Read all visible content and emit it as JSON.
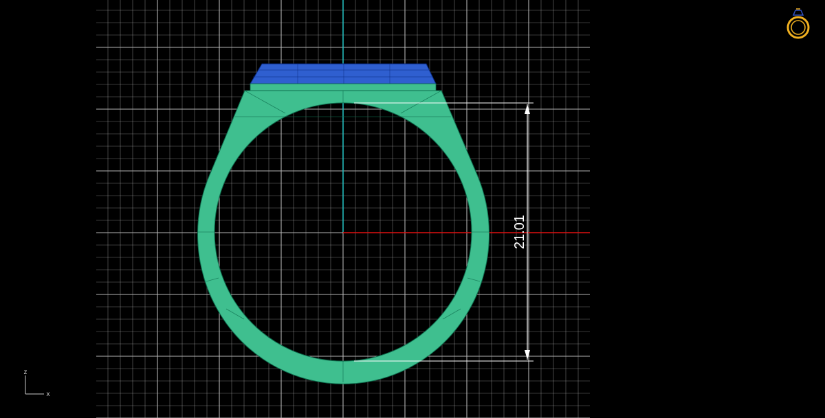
{
  "viewport": {
    "background": "#000000",
    "grid_color": "#bdbdbd",
    "axis_x_color": "#e01010",
    "axis_y_color": "#20c0c0"
  },
  "model": {
    "band_color": "#3fbf8f",
    "band_edge_color": "#0f6f4f",
    "top_color": "#2f5fd0",
    "top_edge_color": "#0a2a80"
  },
  "dimension": {
    "value": "21.01",
    "color": "#ffffff"
  },
  "axis_triad": {
    "z_label": "z",
    "x_label": "x",
    "color": "#c8c8c8"
  },
  "ring_icon": {
    "icon": "ring-icon",
    "color": "#f0b020"
  }
}
